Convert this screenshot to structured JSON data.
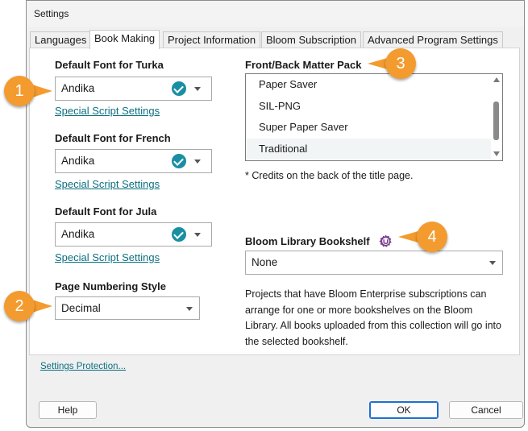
{
  "window": {
    "title": "Settings"
  },
  "tabs": [
    {
      "label": "Languages",
      "active": false
    },
    {
      "label": "Book Making",
      "active": true
    },
    {
      "label": "Project Information",
      "active": false
    },
    {
      "label": "Bloom Subscription",
      "active": false
    },
    {
      "label": "Advanced Program Settings",
      "active": false
    }
  ],
  "fonts": [
    {
      "label": "Default Font for Turka",
      "value": "Andika",
      "link": "Special Script Settings"
    },
    {
      "label": "Default Font for French",
      "value": "Andika",
      "link": "Special Script Settings"
    },
    {
      "label": "Default Font for Jula",
      "value": "Andika",
      "link": "Special Script Settings"
    }
  ],
  "page_numbering": {
    "label": "Page Numbering Style",
    "value": "Decimal"
  },
  "matter_pack": {
    "label": "Front/Back Matter Pack",
    "items": [
      "Paper Saver",
      "SIL-PNG",
      "Super Paper Saver",
      "Traditional"
    ],
    "selected": "Traditional",
    "note": "* Credits on the back of the title page."
  },
  "bookshelf": {
    "label": "Bloom Library Bookshelf",
    "value": "None",
    "description": "Projects that have Bloom Enterprise subscriptions can arrange for one or more bookshelves on the Bloom Library. All books uploaded from this collection will go into the selected bookshelf."
  },
  "footer": {
    "settings_protection": "Settings Protection...",
    "help": "Help",
    "ok": "OK",
    "cancel": "Cancel"
  },
  "callouts": [
    "1",
    "2",
    "3",
    "4"
  ],
  "colors": {
    "accent": "#1a8fa3",
    "callout": "#f39b2e",
    "link": "#0b6f80",
    "gear": "#7b3f8e"
  },
  "icons": [
    "check-circle-icon",
    "chevron-down-icon",
    "gear-icon",
    "scroll-up-arrow-icon",
    "scroll-down-arrow-icon"
  ]
}
